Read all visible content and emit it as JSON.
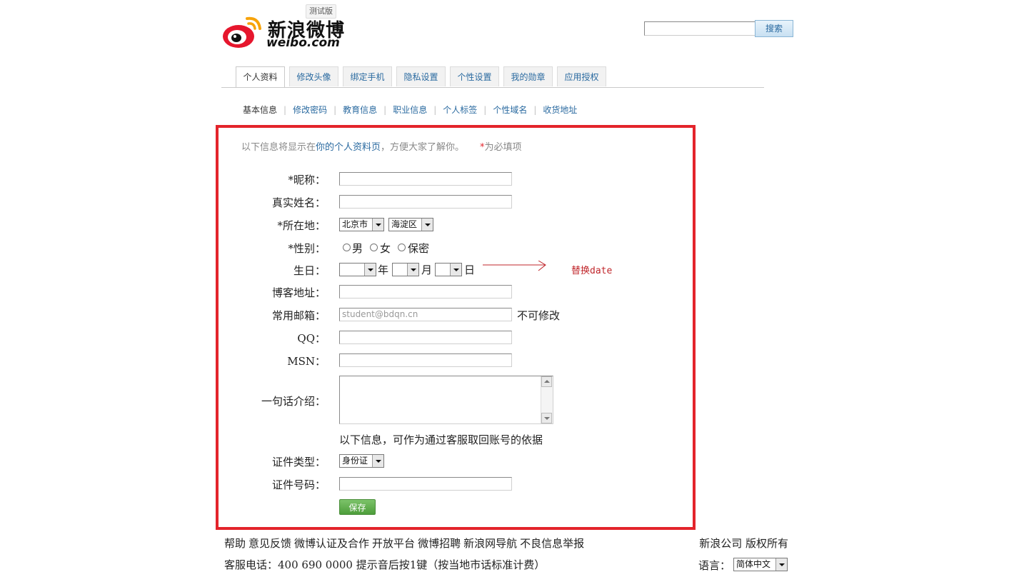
{
  "header": {
    "logo_cn": "新浪微博",
    "logo_en": "weibo.com",
    "beta_badge": "测试版",
    "search_button": "搜索",
    "search_value": ""
  },
  "tabs": [
    {
      "label": "个人资料",
      "active": true
    },
    {
      "label": "修改头像"
    },
    {
      "label": "绑定手机"
    },
    {
      "label": "隐私设置"
    },
    {
      "label": "个性设置"
    },
    {
      "label": "我的勋章"
    },
    {
      "label": "应用授权"
    }
  ],
  "subnav": [
    "基本信息",
    "修改密码",
    "教育信息",
    "职业信息",
    "个人标签",
    "个性域名",
    "收货地址"
  ],
  "form": {
    "intro_before": "以下信息将显示在",
    "intro_link": "你的个人资料页",
    "intro_after": "，方便大家了解你。",
    "required_mark": "*",
    "required_text": "为必填项",
    "nickname_label": "*昵称：",
    "realname_label": "真实姓名：",
    "location_label": "*所在地：",
    "province_value": "北京市",
    "district_value": "海淀区",
    "gender_label": "*性别：",
    "gender_options": [
      "男",
      "女",
      "保密"
    ],
    "birthday_label": "生日：",
    "year_unit": "年",
    "month_unit": "月",
    "day_unit": "日",
    "blog_label": "博客地址：",
    "email_label": "常用邮箱：",
    "email_value": "student@bdqn.cn",
    "email_note": "不可修改",
    "qq_label": "QQ：",
    "msn_label": "MSN：",
    "bio_label": "一句话介绍：",
    "recovery_note": "以下信息，可作为通过客服取回账号的依据",
    "idtype_label": "证件类型：",
    "idtype_value": "身份证",
    "idnumber_label": "证件号码：",
    "save_button": "保存"
  },
  "annotation": {
    "text": "替换date",
    "color": "#c0262b"
  },
  "footer": {
    "links": [
      "帮助",
      "意见反馈",
      "微博认证及合作",
      "开放平台",
      "微博招聘",
      "新浪网导航",
      "不良信息举报"
    ],
    "copyright": "新浪公司 版权所有",
    "hotline": "客服电话：400 690 0000 提示音后按1键（按当地市话标准计费）",
    "language_label": "语言：",
    "language_value": "简体中文"
  },
  "colors": {
    "link": "#2a6aa0",
    "highlight_border": "#e3242b",
    "save_button": "#5aad45"
  }
}
